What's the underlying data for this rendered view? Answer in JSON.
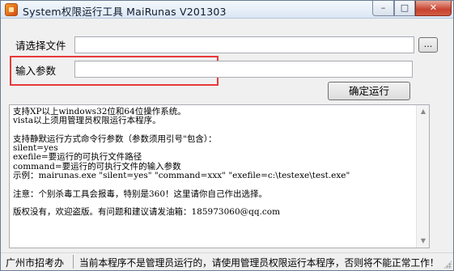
{
  "window": {
    "title": "System权限运行工具  MaiRunas V201303",
    "minimize_glyph": "–",
    "maximize_glyph": "□",
    "close_glyph": "✕"
  },
  "form": {
    "file_label": "请选择文件",
    "file_value": "",
    "browse_label": "...",
    "param_label": "输入参数",
    "param_value": "",
    "run_button": "确定运行"
  },
  "info": {
    "lines": [
      "支持XP以上windows32位和64位操作系统。",
      "vista以上须用管理员权限运行本程序。",
      "",
      "支持静默运行方式命令行参数（参数须用引号\"包含）：",
      "silent=yes",
      "exefile=要运行的可执行文件路径",
      "command=要运行的可执行文件的输入参数",
      "示例：mairunas.exe \"silent=yes\" \"command=xxx\" \"exefile=c:\\testexe\\test.exe\"",
      "",
      "注意：个别杀毒工具会报毒，特别是360！这里请你自己作出选择。",
      "",
      "版权没有，欢迎盗版。有问题和建议请发油箱：185973060@qq.com"
    ]
  },
  "statusbar": {
    "left": "广州市招考办",
    "right": "当前本程序不是管理员运行的，请使用管理员权限运行本程序，否则将不能正常工作！"
  },
  "colors": {
    "highlight_box": "#e8393b",
    "window_bg": "#f0f0f0"
  }
}
